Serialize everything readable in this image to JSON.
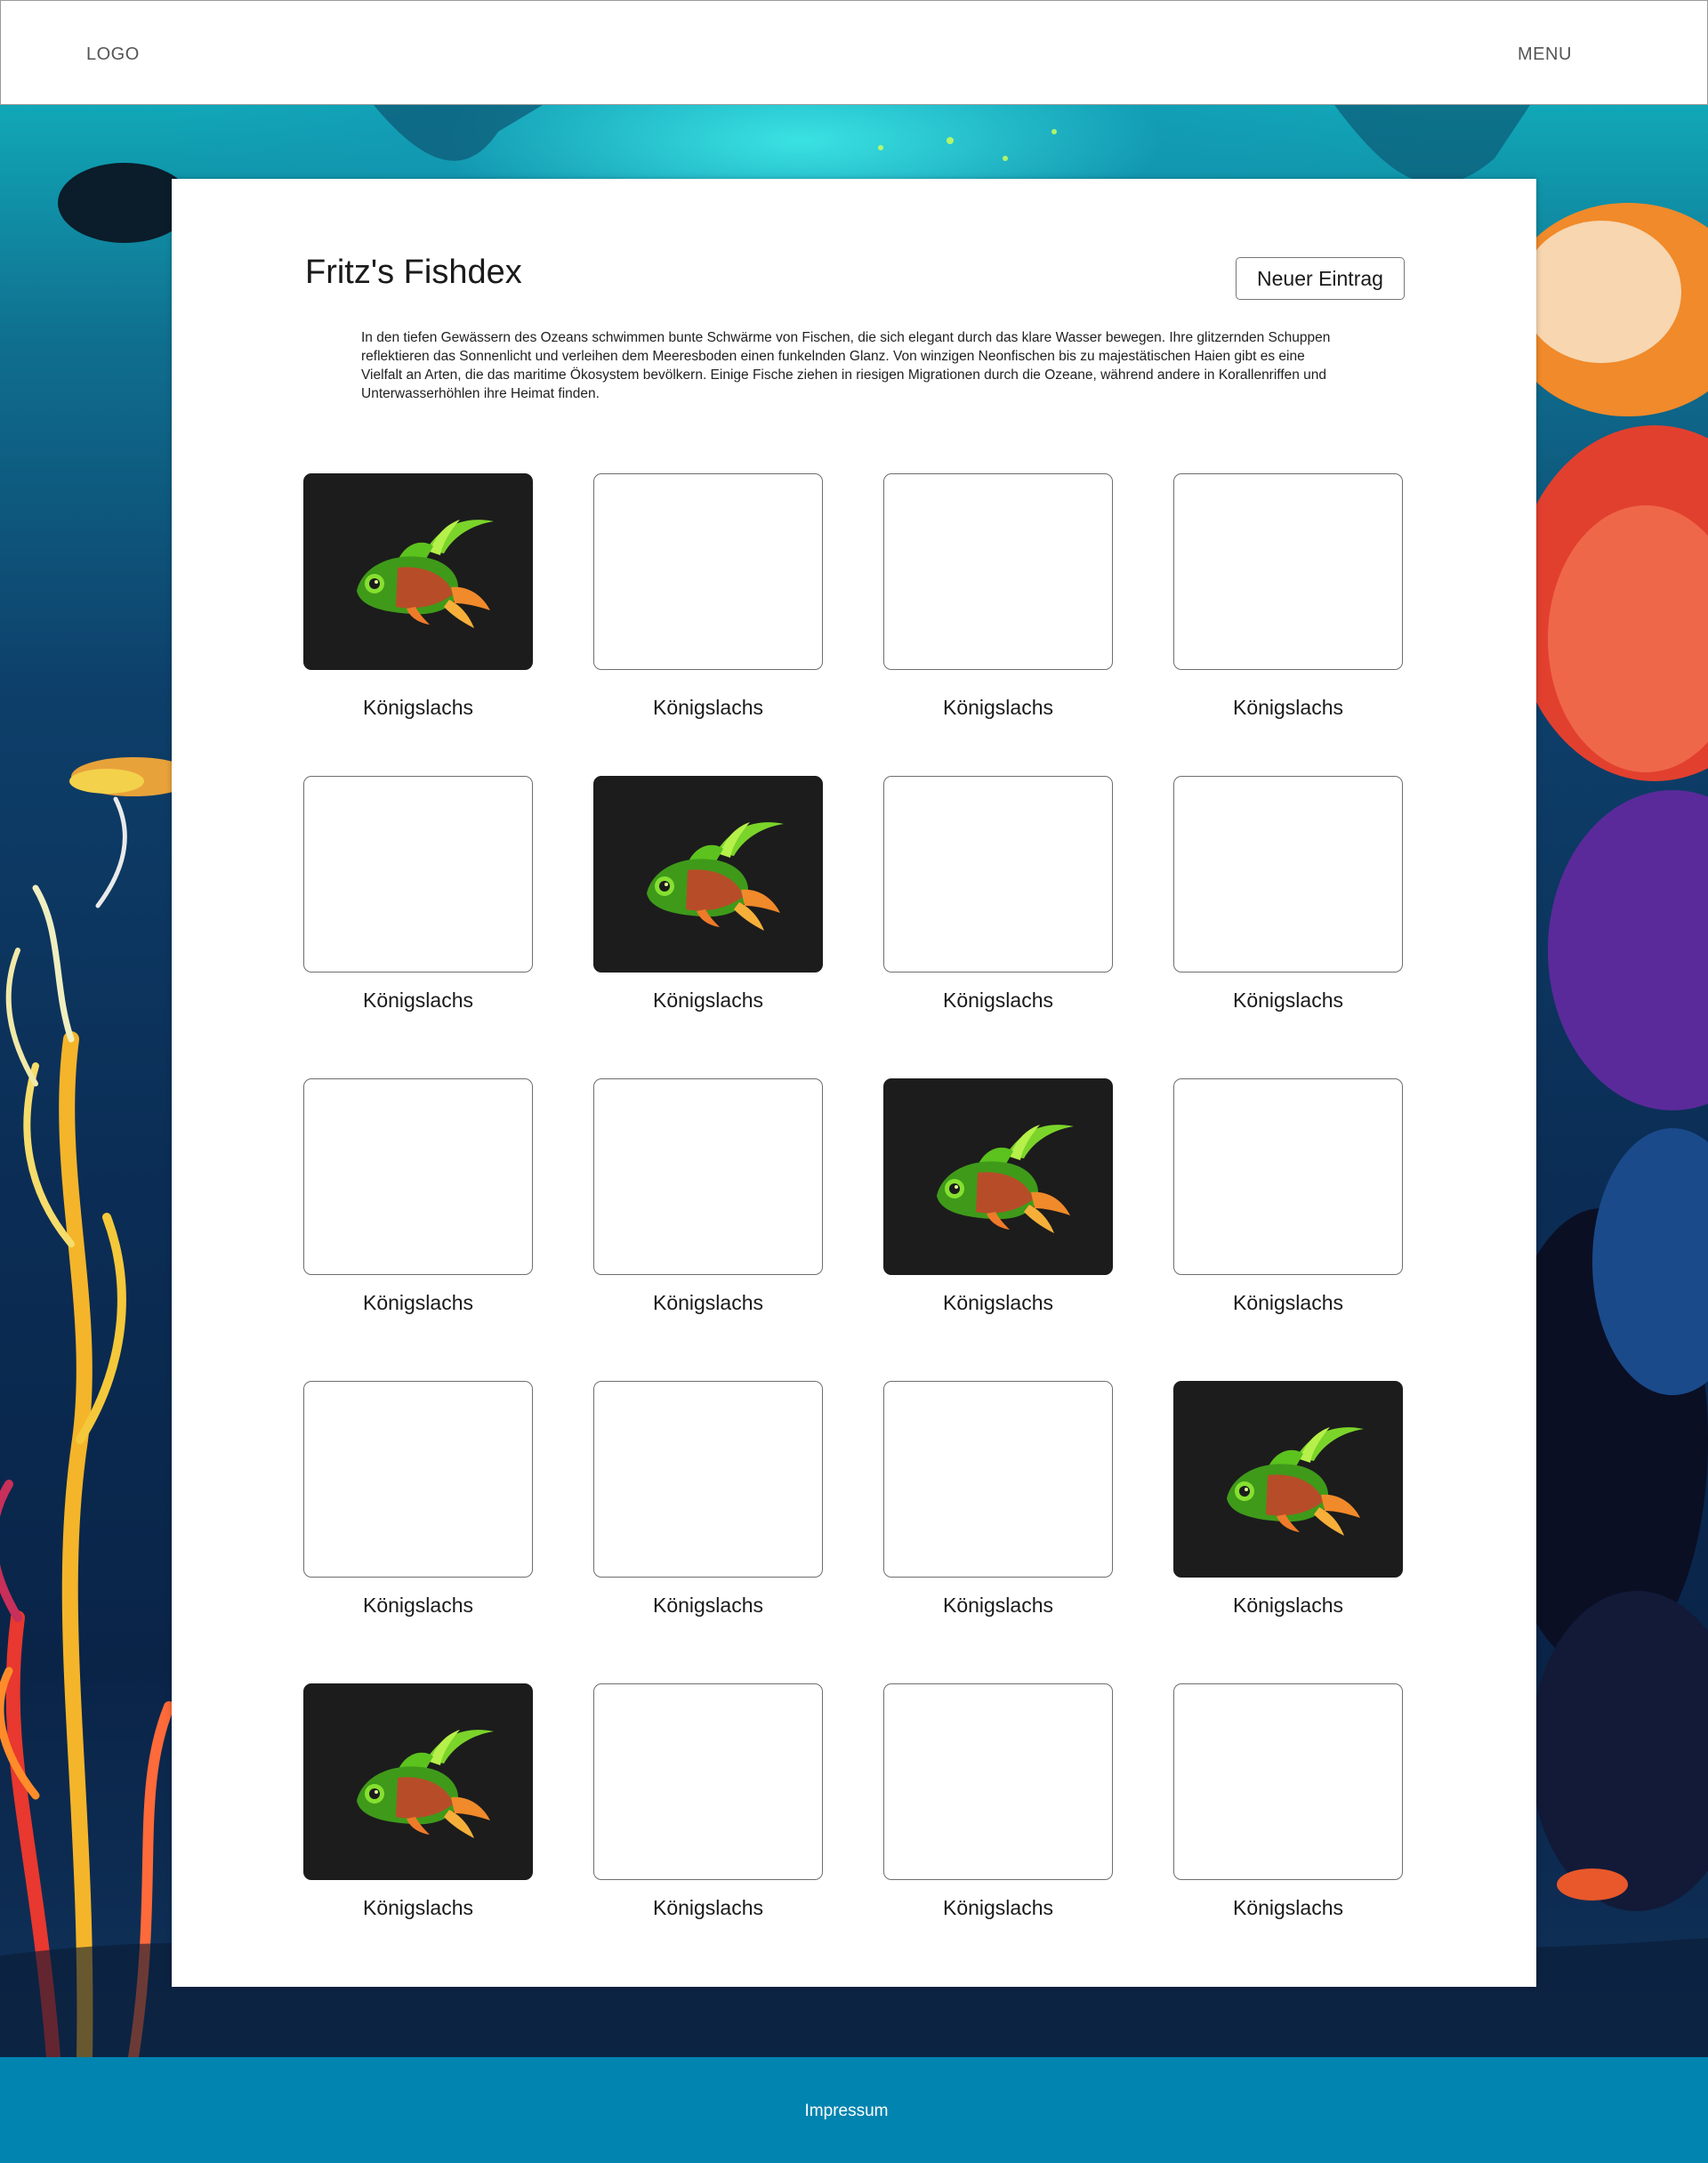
{
  "header": {
    "logo": "LOGO",
    "menu": "MENU"
  },
  "page": {
    "title": "Fritz's Fishdex",
    "new_entry_label": "Neuer Eintrag",
    "intro": "In den tiefen Gewässern des Ozeans schwimmen bunte Schwärme von Fischen, die sich elegant durch das klare Wasser bewegen. Ihre glitzernden Schuppen reflektieren das Sonnenlicht und verleihen dem Meeresboden einen funkelnden Glanz. Von winzigen Neonfischen bis zu majestätischen Haien gibt es eine Vielfalt an Arten, die das maritime Ökosystem bevölkern. Einige Fische ziehen in riesigen Migrationen durch die Ozeane, während andere in Korallenriffen und Unterwasserhöhlen ihre Heimat finden."
  },
  "grid": {
    "rows": [
      [
        {
          "label": "Königslachs",
          "image": "fish-image"
        },
        {
          "label": "Königslachs",
          "image": "empty"
        },
        {
          "label": "Königslachs",
          "image": "empty"
        },
        {
          "label": "Königslachs",
          "image": "empty"
        }
      ],
      [
        {
          "label": "Königslachs",
          "image": "empty"
        },
        {
          "label": "Königslachs",
          "image": "fish-image"
        },
        {
          "label": "Königslachs",
          "image": "empty"
        },
        {
          "label": "Königslachs",
          "image": "empty"
        }
      ],
      [
        {
          "label": "Königslachs",
          "image": "empty"
        },
        {
          "label": "Königslachs",
          "image": "empty"
        },
        {
          "label": "Königslachs",
          "image": "fish-image"
        },
        {
          "label": "Königslachs",
          "image": "empty"
        }
      ],
      [
        {
          "label": "Königslachs",
          "image": "empty"
        },
        {
          "label": "Königslachs",
          "image": "empty"
        },
        {
          "label": "Königslachs",
          "image": "empty"
        },
        {
          "label": "Königslachs",
          "image": "fish-image"
        }
      ],
      [
        {
          "label": "Königslachs",
          "image": "fish-image"
        },
        {
          "label": "Königslachs",
          "image": "empty"
        },
        {
          "label": "Königslachs",
          "image": "empty"
        },
        {
          "label": "Königslachs",
          "image": "empty"
        }
      ]
    ]
  },
  "footer": {
    "impressum": "Impressum"
  },
  "colors": {
    "footer": "#0284b0",
    "tile_dark": "#1c1c1c"
  }
}
